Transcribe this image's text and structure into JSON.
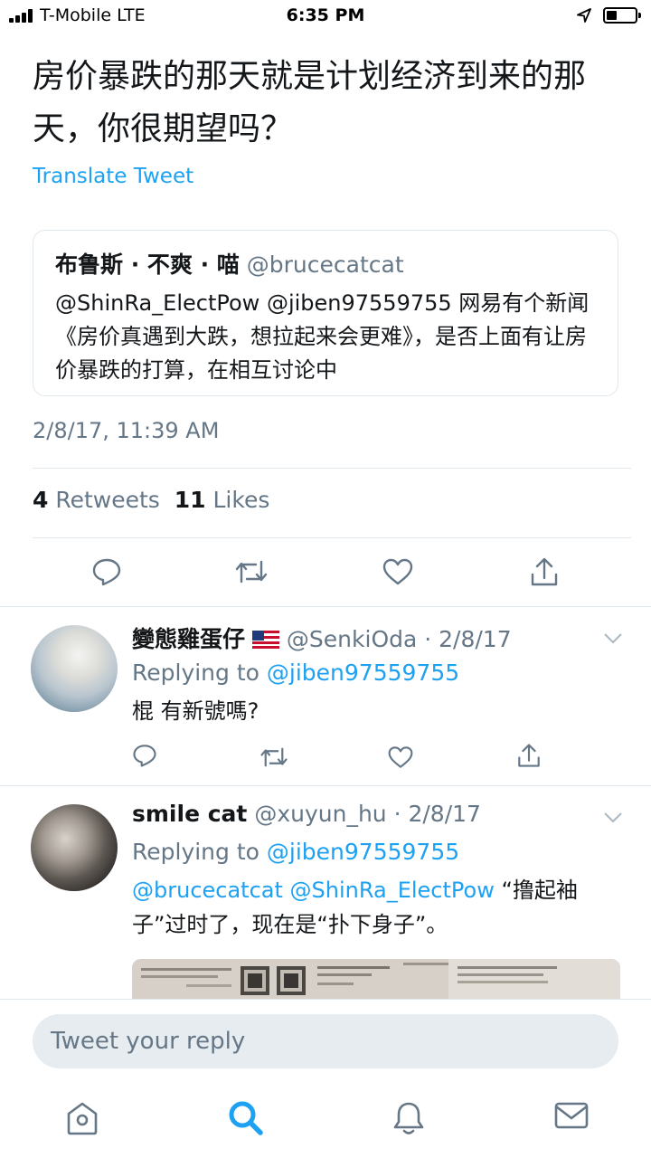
{
  "status_bar": {
    "carrier": "T-Mobile  LTE",
    "time": "6:35 PM",
    "battery_level": 0.35
  },
  "tweet": {
    "text": "房价暴跌的那天就是计划经济到来的那天，你很期望吗？",
    "translate_label": "Translate Tweet",
    "quoted": {
      "name": "布鲁斯 · 不爽 · 喵",
      "handle": "@brucecatcat",
      "text": "@ShinRa_ElectPow @jiben97559755 网易有个新闻《房价真遇到大跌，想拉起来会更难》，是否上面有让房价暴跌的打算，在相互讨论中"
    },
    "timestamp": "2/8/17, 11:39 AM",
    "retweets_count": "4",
    "retweets_label": "Retweets",
    "likes_count": "11",
    "likes_label": "Likes"
  },
  "replies": [
    {
      "name": "變態雞蛋仔",
      "handle_date": "@SenkiOda · 2/8/17",
      "replying_prefix": "Replying to",
      "replying_to": "@jiben97559755",
      "text": "棍 有新號嗎?"
    },
    {
      "name": "smile cat",
      "handle_date": "@xuyun_hu · 2/8/17",
      "replying_prefix": "Replying to",
      "replying_to": "@jiben97559755",
      "mentions": "@brucecatcat @ShinRa_ElectPow",
      "text": " “撸起袖子”过时了，现在是“扑下身子”。"
    }
  ],
  "reply_bar": {
    "placeholder": "Tweet your reply"
  },
  "tabs": [
    "home-icon",
    "search-icon",
    "notifications-icon",
    "messages-icon"
  ],
  "colors": {
    "accent": "#1da1f2",
    "secondary_text": "#657786",
    "divider": "#e1e8ed"
  }
}
